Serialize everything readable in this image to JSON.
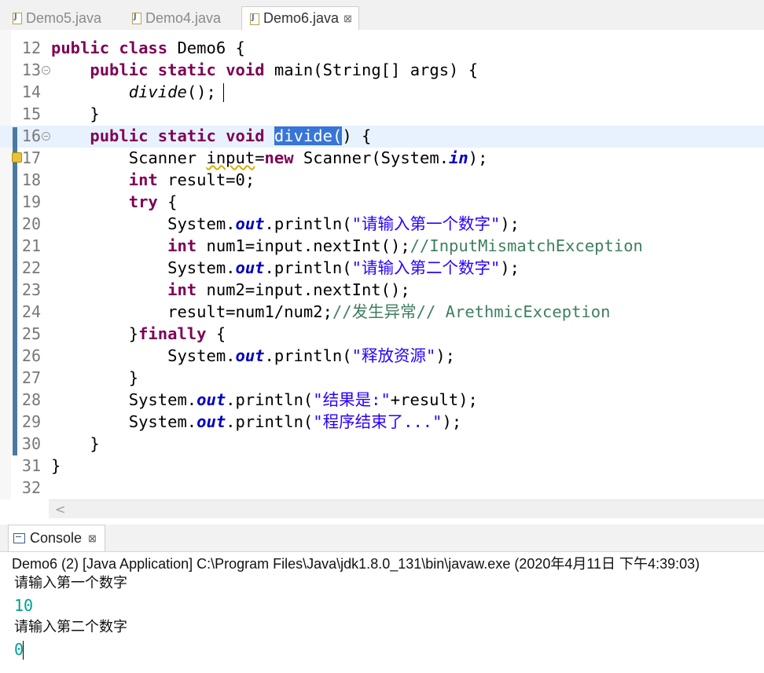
{
  "editor_tabs": [
    {
      "label": "Demo5.java",
      "active": false
    },
    {
      "label": "Demo4.java",
      "active": false
    },
    {
      "label": "Demo6.java",
      "active": true,
      "close": "⊠"
    }
  ],
  "colors": {
    "keyword": "#7f0055",
    "static_field": "#0000c0",
    "string": "#2a00ff",
    "comment": "#3f7f5f",
    "selection": "#3875d7",
    "console_input": "#00a090",
    "current_line": "#e8f2fe"
  },
  "code_lines": [
    {
      "n": "12",
      "tokens": [
        {
          "t": "public",
          "c": "kw"
        },
        {
          "t": " "
        },
        {
          "t": "class",
          "c": "kw"
        },
        {
          "t": " Demo6 {"
        }
      ]
    },
    {
      "n": "13",
      "fold": true,
      "tokens": [
        {
          "t": "    "
        },
        {
          "t": "public",
          "c": "kw"
        },
        {
          "t": " "
        },
        {
          "t": "static",
          "c": "kw"
        },
        {
          "t": " "
        },
        {
          "t": "void",
          "c": "kw"
        },
        {
          "t": " main(String[] args) {"
        }
      ]
    },
    {
      "n": "14",
      "tokens": [
        {
          "t": "        "
        },
        {
          "t": "divide",
          "c": "ital"
        },
        {
          "t": "();"
        }
      ]
    },
    {
      "n": "15",
      "tokens": [
        {
          "t": "    }"
        }
      ]
    },
    {
      "n": "16",
      "fold": true,
      "tokens": [
        {
          "t": "    "
        },
        {
          "t": "public",
          "c": "kw"
        },
        {
          "t": " "
        },
        {
          "t": "static",
          "c": "kw"
        },
        {
          "t": " "
        },
        {
          "t": "void",
          "c": "kw"
        },
        {
          "t": " "
        },
        {
          "t": "divide(",
          "c": "sel"
        },
        {
          "t": ") {"
        }
      ]
    },
    {
      "n": "17",
      "tokens": [
        {
          "t": "        Scanner "
        },
        {
          "t": "input",
          "c": "warnunder"
        },
        {
          "t": "="
        },
        {
          "t": "new",
          "c": "kw"
        },
        {
          "t": " Scanner(System."
        },
        {
          "t": "in",
          "c": "fld"
        },
        {
          "t": ");"
        }
      ]
    },
    {
      "n": "18",
      "tokens": [
        {
          "t": "        "
        },
        {
          "t": "int",
          "c": "kw"
        },
        {
          "t": " result=0;"
        }
      ]
    },
    {
      "n": "19",
      "tokens": [
        {
          "t": "        "
        },
        {
          "t": "try",
          "c": "kw"
        },
        {
          "t": " {"
        }
      ]
    },
    {
      "n": "20",
      "tokens": [
        {
          "t": "            System."
        },
        {
          "t": "out",
          "c": "fld"
        },
        {
          "t": ".println("
        },
        {
          "t": "\"请输入第一个数字\"",
          "c": "str"
        },
        {
          "t": ");"
        }
      ]
    },
    {
      "n": "21",
      "tokens": [
        {
          "t": "            "
        },
        {
          "t": "int",
          "c": "kw"
        },
        {
          "t": " num1=input.nextInt();"
        },
        {
          "t": "//InputMismatchException",
          "c": "cmt"
        }
      ]
    },
    {
      "n": "22",
      "tokens": [
        {
          "t": "            System."
        },
        {
          "t": "out",
          "c": "fld"
        },
        {
          "t": ".println("
        },
        {
          "t": "\"请输入第二个数字\"",
          "c": "str"
        },
        {
          "t": ");"
        }
      ]
    },
    {
      "n": "23",
      "tokens": [
        {
          "t": "            "
        },
        {
          "t": "int",
          "c": "kw"
        },
        {
          "t": " num2=input.nextInt();"
        }
      ]
    },
    {
      "n": "24",
      "tokens": [
        {
          "t": "            result=num1/num2;"
        },
        {
          "t": "//发生异常// ArethmicException",
          "c": "cmt"
        }
      ]
    },
    {
      "n": "25",
      "tokens": [
        {
          "t": "        }"
        },
        {
          "t": "finally",
          "c": "kw"
        },
        {
          "t": " {"
        }
      ]
    },
    {
      "n": "26",
      "tokens": [
        {
          "t": "            System."
        },
        {
          "t": "out",
          "c": "fld"
        },
        {
          "t": ".println("
        },
        {
          "t": "\"释放资源\"",
          "c": "str"
        },
        {
          "t": ");"
        }
      ]
    },
    {
      "n": "27",
      "tokens": [
        {
          "t": "        }"
        }
      ]
    },
    {
      "n": "28",
      "tokens": [
        {
          "t": "        System."
        },
        {
          "t": "out",
          "c": "fld"
        },
        {
          "t": ".println("
        },
        {
          "t": "\"结果是:\"",
          "c": "str"
        },
        {
          "t": "+result);"
        }
      ]
    },
    {
      "n": "29",
      "tokens": [
        {
          "t": "        System."
        },
        {
          "t": "out",
          "c": "fld"
        },
        {
          "t": ".println("
        },
        {
          "t": "\"程序结束了...\"",
          "c": "str"
        },
        {
          "t": ");"
        }
      ]
    },
    {
      "n": "30",
      "tokens": [
        {
          "t": "    }"
        }
      ]
    },
    {
      "n": "31",
      "tokens": [
        {
          "t": "}"
        }
      ]
    },
    {
      "n": "32",
      "tokens": []
    }
  ],
  "scrollbar": {
    "left_arrow": "<"
  },
  "console": {
    "tab_label": "Console",
    "tab_close": "⊠",
    "launch_description": "Demo6 (2) [Java Application] C:\\Program Files\\Java\\jdk1.8.0_131\\bin\\javaw.exe (2020年4月11日 下午4:39:03)",
    "output": [
      {
        "text": "请输入第一个数字",
        "kind": "out"
      },
      {
        "text": "10",
        "kind": "in"
      },
      {
        "text": "请输入第二个数字",
        "kind": "out"
      },
      {
        "text": "0",
        "kind": "in"
      }
    ]
  }
}
